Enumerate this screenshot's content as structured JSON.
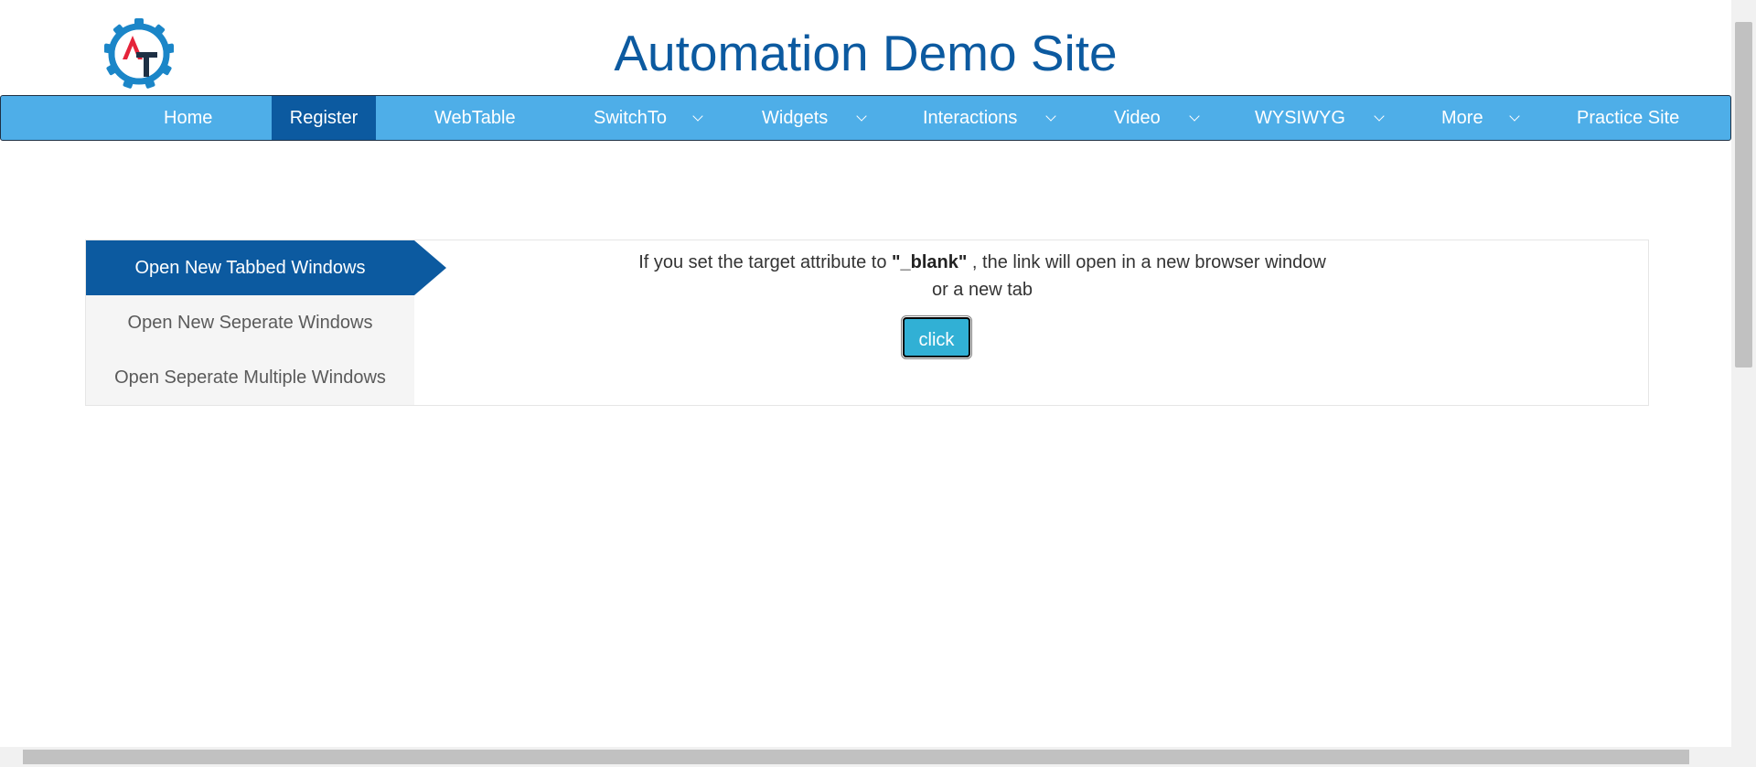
{
  "header": {
    "title": "Automation Demo Site",
    "logo_letters": "AT",
    "logo_colors": {
      "gear": "#1b86c8",
      "a": "#e5243a",
      "t": "#1e3044"
    }
  },
  "nav": {
    "items": [
      {
        "label": "Home",
        "dropdown": false
      },
      {
        "label": "Register",
        "dropdown": false,
        "active": true
      },
      {
        "label": "WebTable",
        "dropdown": false
      },
      {
        "label": "SwitchTo",
        "dropdown": true
      },
      {
        "label": "Widgets",
        "dropdown": true
      },
      {
        "label": "Interactions",
        "dropdown": true
      },
      {
        "label": "Video",
        "dropdown": true
      },
      {
        "label": "WYSIWYG",
        "dropdown": true
      },
      {
        "label": "More",
        "dropdown": true
      },
      {
        "label": "Practice Site",
        "dropdown": false
      }
    ],
    "dropdown_icon": "chevron-down-icon"
  },
  "tabs": {
    "items": [
      {
        "label": "Open New Tabbed Windows",
        "active": true
      },
      {
        "label": "Open New Seperate Windows",
        "active": false
      },
      {
        "label": "Open Seperate Multiple Windows",
        "active": false
      }
    ]
  },
  "content": {
    "text_before": "If you set the target attribute to ",
    "keyword": "\"_blank\"",
    "text_after": " , the link will open in a new browser window",
    "line2": "or a new tab",
    "button_label": "click"
  },
  "colors": {
    "primary": "#0c5aa0",
    "nav_bg": "#4eaee8",
    "button_bg": "#31b0d5",
    "tab_inactive_bg": "#f5f5f5"
  }
}
